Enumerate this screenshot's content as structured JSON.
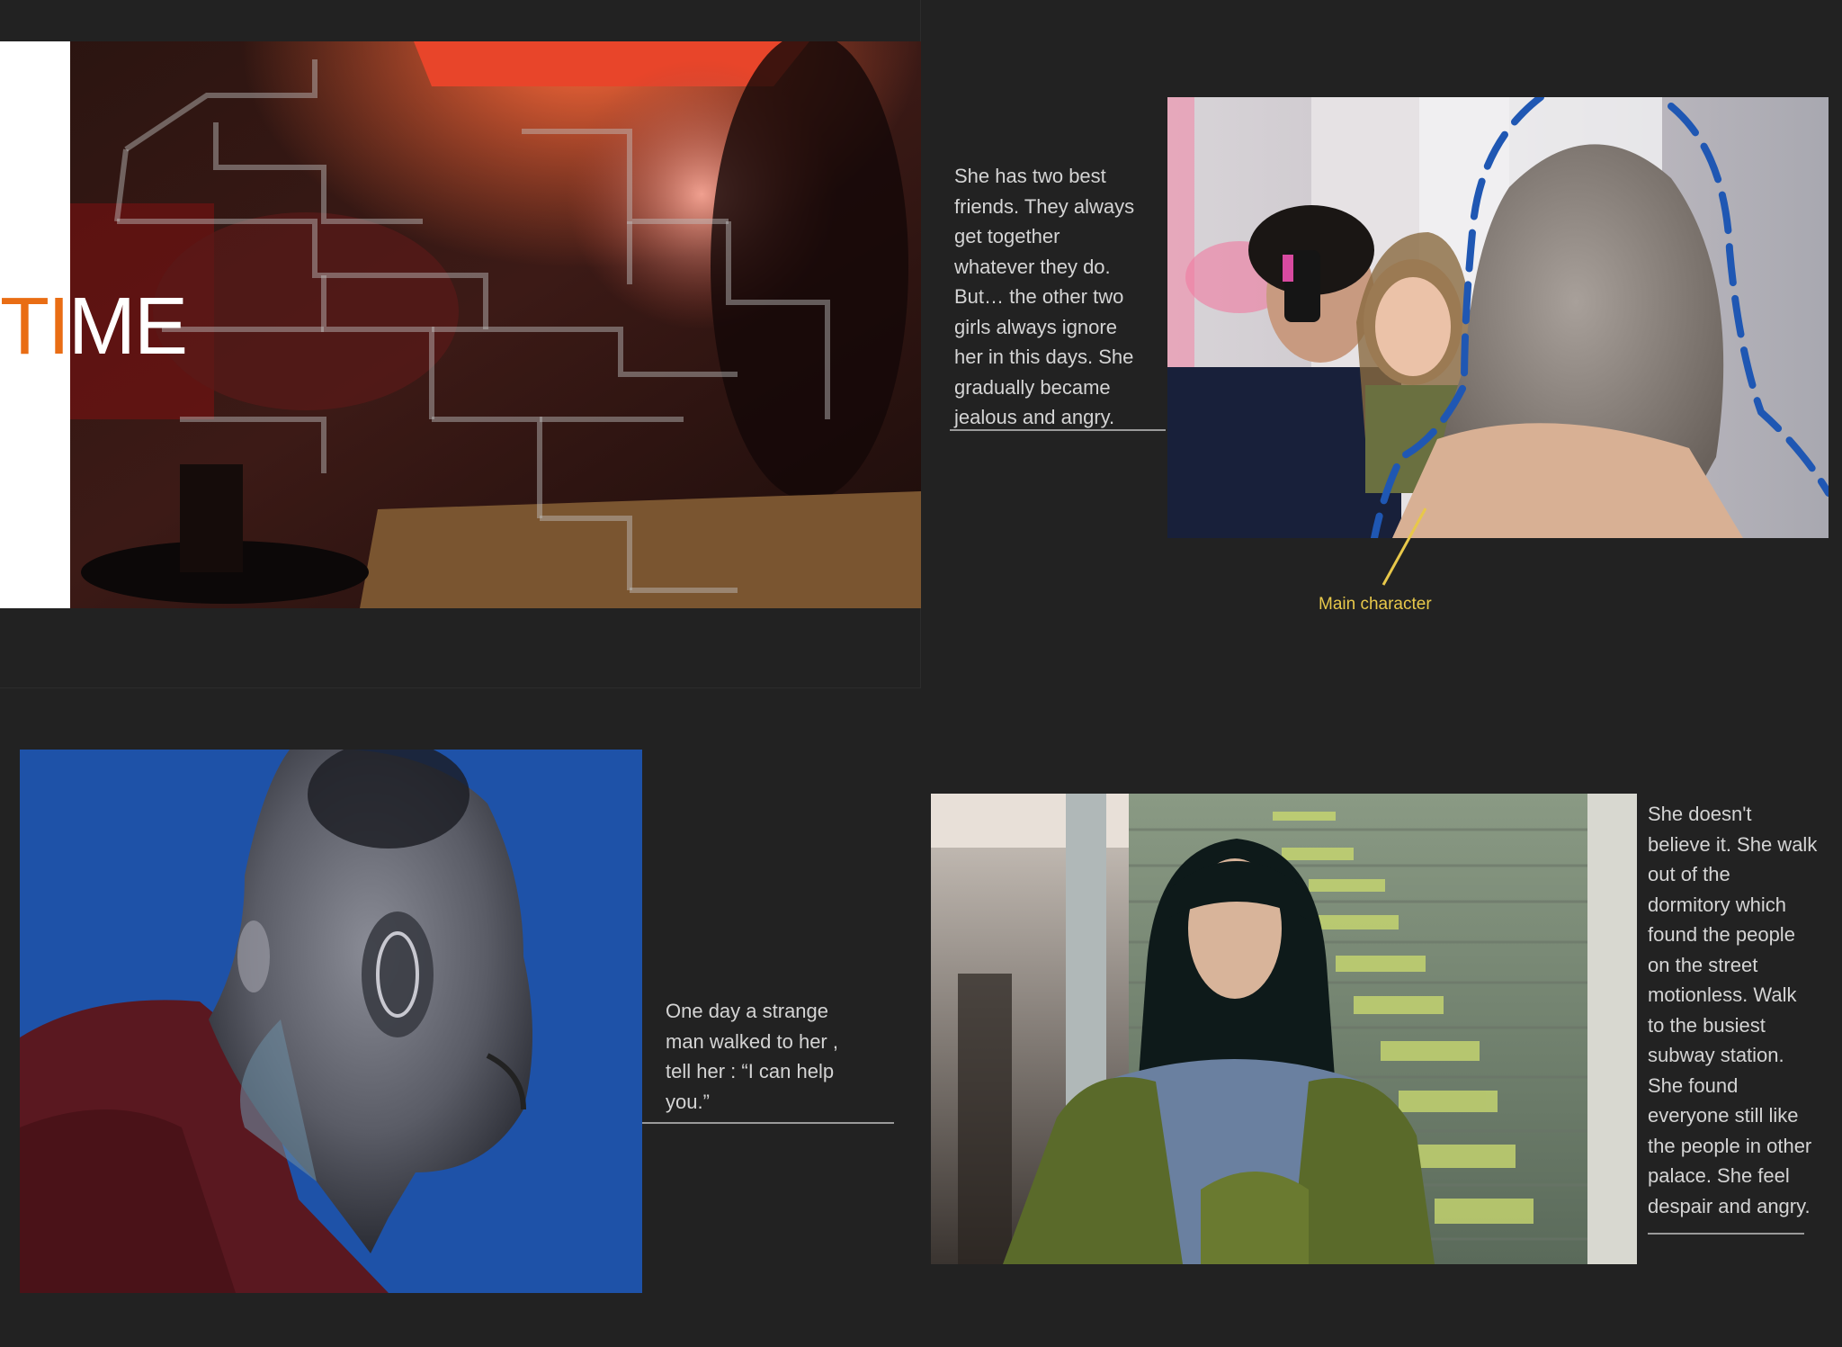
{
  "title": {
    "accent": "TI",
    "rest": "ME"
  },
  "panels": {
    "top_right": {
      "text": "She has two best\nfriends. They always\nget together\nwhatever they do.\nBut… the other two\ngirls always ignore\nher in this days. She\ngradually became\njealous and angry.",
      "callout": "Main character"
    },
    "bottom_left": {
      "text": "One day a strange\nman walked to her ,\ntell her : “I can help\nyou.”"
    },
    "bottom_right": {
      "text": "She doesn't\nbelieve it. She walk\nout of the\ndormitory which\nfound the people\non the street\nmotionless. Walk\nto the busiest\nsubway station.\nShe found\neveryone still like\nthe people in other\npalace. She feel\ndespair and angry."
    }
  },
  "colors": {
    "background": "#222222",
    "accent_orange": "#e96d14",
    "callout_yellow": "#e8c84a",
    "outline_blue": "#1f57b3",
    "chroma_blue": "#1e52a8"
  },
  "icons": {
    "annotation_outline": "dashed-outline",
    "pointer_line": "pointer-line"
  }
}
